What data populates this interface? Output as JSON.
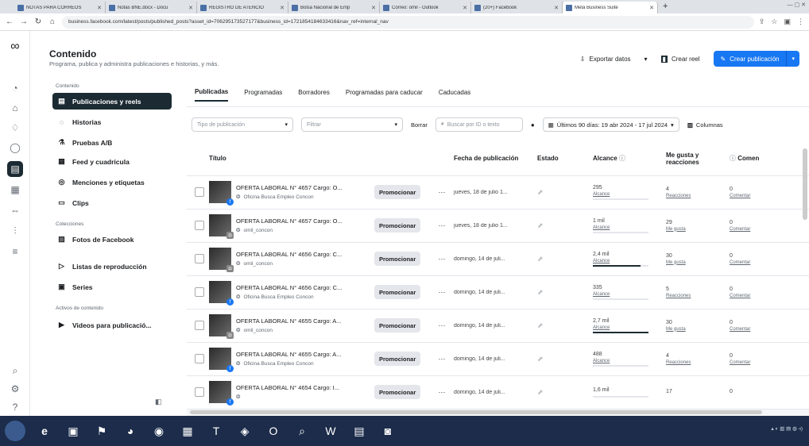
{
  "browser": {
    "tabs": [
      {
        "label": "NOTAS PARA CORREOS",
        "active": false
      },
      {
        "label": "Notas BNE.docx - Docu",
        "active": false
      },
      {
        "label": "REGISTRO DE ATENCIÓ",
        "active": false
      },
      {
        "label": "Bolsa Nacional de Emp",
        "active": false
      },
      {
        "label": "Correo: omil - Outlook",
        "active": false
      },
      {
        "label": "(20+) Facebook",
        "active": false
      },
      {
        "label": "Meta Business Suite",
        "active": true
      }
    ],
    "url": "business.facebook.com/latest/posts/published_posts?asset_id=706295173527177&business_id=1721854184633416&nav_ref=internal_nav"
  },
  "header": {
    "title": "Contenido",
    "subtitle": "Programa, publica y administra publicaciones e historias, y más.",
    "export_label": "Exportar datos",
    "create_reel_label": "Crear reel",
    "create_post_label": "Crear publicación"
  },
  "sidebar": {
    "section_content": "Contenido",
    "section_collections": "Colecciones",
    "section_assets": "Activos de contenido",
    "items": [
      {
        "label": "Publicaciones y reels",
        "icon": "posts-icon"
      },
      {
        "label": "Historias",
        "icon": "stories-icon"
      },
      {
        "label": "Pruebas A/B",
        "icon": "ab-test-icon"
      },
      {
        "label": "Feed y cuadrícula",
        "icon": "feed-icon"
      },
      {
        "label": "Menciones y etiquetas",
        "icon": "mentions-icon"
      },
      {
        "label": "Clips",
        "icon": "clips-icon"
      },
      {
        "label": "Fotos de Facebook",
        "icon": "photos-icon"
      },
      {
        "label": "Listas de reproducción",
        "icon": "playlist-icon"
      },
      {
        "label": "Series",
        "icon": "series-icon"
      },
      {
        "label": "Videos para publicació...",
        "icon": "video-icon"
      }
    ]
  },
  "tabs": [
    "Publicadas",
    "Programadas",
    "Borradores",
    "Programadas para caducar",
    "Caducadas"
  ],
  "filters": {
    "type_placeholder": "Tipo de publicación",
    "filter_placeholder": "Filtrar",
    "clear_label": "Borrar",
    "search_placeholder": "Buscar por ID o texto",
    "date_range": "Últimos 90 días: 19 abr 2024 - 17 jul 2024",
    "columns_label": "Columnas"
  },
  "table": {
    "headers": {
      "title": "Título",
      "date": "Fecha de publicación",
      "status": "Estado",
      "reach": "Alcance",
      "likes": "Me gusta y reacciones",
      "comments": "Comen"
    },
    "promote_label": "Promocionar",
    "rows": [
      {
        "title": "OFERTA LABORAL N° 4657 Cargo: O...",
        "account": "Oficina Busca Empleo Concon",
        "platform": "fb",
        "date": "jueves, 18 de julio 1...",
        "reach": "295",
        "reach_label": "Alcance",
        "reach_frac": 0.0,
        "likes": "4",
        "likes_label": "Reacciones",
        "comments": "0",
        "comments_label": "Comentar"
      },
      {
        "title": "OFERTA LABORAL N° 4657 Cargo: O...",
        "account": "omil_concon",
        "platform": "ig",
        "date": "jueves, 18 de julio 1...",
        "reach": "1 mil",
        "reach_label": "Alcance",
        "reach_frac": 0.0,
        "likes": "29",
        "likes_label": "Me gusta",
        "comments": "0",
        "comments_label": "Comentar"
      },
      {
        "title": "OFERTA LABORAL N° 4656 Cargo: C...",
        "account": "omil_concon",
        "platform": "ig",
        "date": "domingo, 14 de juli...",
        "reach": "2,4 mil",
        "reach_label": "Alcance",
        "reach_frac": 0.85,
        "likes": "30",
        "likes_label": "Me gusta",
        "comments": "0",
        "comments_label": "Comentar"
      },
      {
        "title": "OFERTA LABORAL N° 4656 Cargo: C...",
        "account": "Oficina Busca Empleo Concon",
        "platform": "fb",
        "date": "domingo, 14 de juli...",
        "reach": "335",
        "reach_label": "Alcance",
        "reach_frac": 0.0,
        "likes": "5",
        "likes_label": "Reacciones",
        "comments": "0",
        "comments_label": "Comentar"
      },
      {
        "title": "OFERTA LABORAL N° 4655 Cargo: A...",
        "account": "omil_concon",
        "platform": "ig",
        "date": "domingo, 14 de juli...",
        "reach": "2,7 mil",
        "reach_label": "Alcance",
        "reach_frac": 1.0,
        "likes": "30",
        "likes_label": "Me gusta",
        "comments": "0",
        "comments_label": "Comentar"
      },
      {
        "title": "OFERTA LABORAL N° 4655 Cargo: A...",
        "account": "Oficina Busca Empleo Concon",
        "platform": "fb",
        "date": "domingo, 14 de juli...",
        "reach": "488",
        "reach_label": "Alcance",
        "reach_frac": 0.0,
        "likes": "4",
        "likes_label": "Reacciones",
        "comments": "0",
        "comments_label": "Comentar"
      },
      {
        "title": "OFERTA LABORAL N° 4654 Cargo: I...",
        "account": "",
        "platform": "fb",
        "date": "domingo, 14 de juli...",
        "reach": "1,6 mil",
        "reach_label": "",
        "reach_frac": 0.0,
        "likes": "17",
        "likes_label": "",
        "comments": "0",
        "comments_label": ""
      }
    ]
  }
}
